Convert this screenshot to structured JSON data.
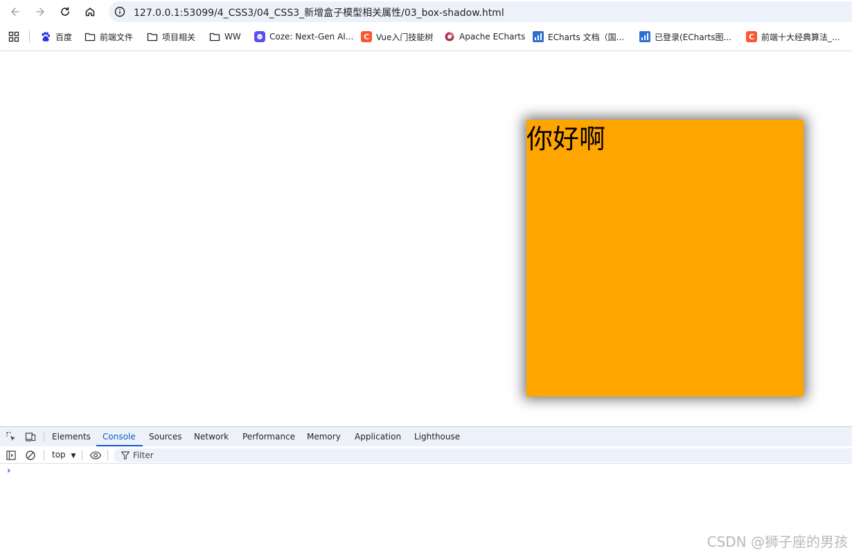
{
  "browser": {
    "url": "127.0.0.1:53099/4_CSS3/04_CSS3_新增盒子模型相关属性/03_box-shadow.html"
  },
  "bookmarks": [
    {
      "label": "百度",
      "icon": "baidu-icon"
    },
    {
      "label": "前端文件",
      "icon": "folder-icon"
    },
    {
      "label": "项目相关",
      "icon": "folder-icon"
    },
    {
      "label": "WW",
      "icon": "folder-icon"
    },
    {
      "label": "Coze: Next-Gen AI...",
      "icon": "coze-icon"
    },
    {
      "label": "Vue入门技能树",
      "icon": "csdn-icon",
      "glyph": "C"
    },
    {
      "label": "Apache ECharts",
      "icon": "echarts-icon"
    },
    {
      "label": "ECharts 文档（国...",
      "icon": "echarts-doc-icon"
    },
    {
      "label": "已登录(ECharts图...",
      "icon": "echarts-doc-icon"
    },
    {
      "label": "前端十大经典算法_...",
      "icon": "csdn-icon",
      "glyph": "C"
    }
  ],
  "page": {
    "box_text": "你好啊",
    "box_color": "#ffa500"
  },
  "devtools": {
    "tabs": [
      "Elements",
      "Console",
      "Sources",
      "Network",
      "Performance",
      "Memory",
      "Application",
      "Lighthouse"
    ],
    "active_tab": "Console",
    "context": "top",
    "filter_placeholder": "Filter",
    "prompt": "›"
  },
  "watermark": "CSDN @狮子座的男孩",
  "colors": {
    "accent": "#0b57d0",
    "omnibox": "#edf2fa"
  }
}
